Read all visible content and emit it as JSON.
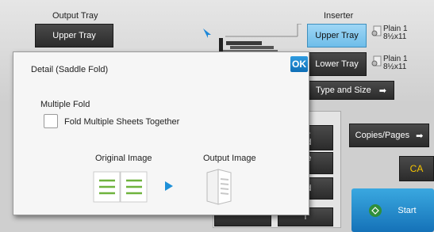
{
  "top": {
    "output_tray_label": "Output Tray",
    "output_tray_value": "Upper Tray",
    "inserter_label": "Inserter",
    "upper_tray_button": "Upper Tray",
    "lower_tray_button": "Lower Tray",
    "upper_paper": {
      "line1": "Plain 1",
      "line2": "8½x11"
    },
    "lower_paper": {
      "line1": "Plain 1",
      "line2": "8½x11"
    },
    "type_and_size_button": "Type and Size"
  },
  "background": {
    "partial_btn_1": "rd-\nold",
    "partial_btn_2": "ple\nd",
    "partial_btn_3": "old",
    "partial_btn_4": "l",
    "copies_pages_button": "Copies/Pages",
    "ca_button": "CA",
    "start_button": "Start"
  },
  "dialog": {
    "title": "Detail (Saddle Fold)",
    "ok_button": "OK",
    "section_label": "Multiple Fold",
    "checkbox_label": "Fold Multiple Sheets Together",
    "checkbox_checked": false,
    "original_image_label": "Original Image",
    "output_image_label": "Output Image"
  },
  "colors": {
    "accent_blue": "#6ebde9",
    "ok_blue": "#1a7fcc",
    "ca_yellow": "#f5c400",
    "preview_green": "#6fb33d"
  }
}
